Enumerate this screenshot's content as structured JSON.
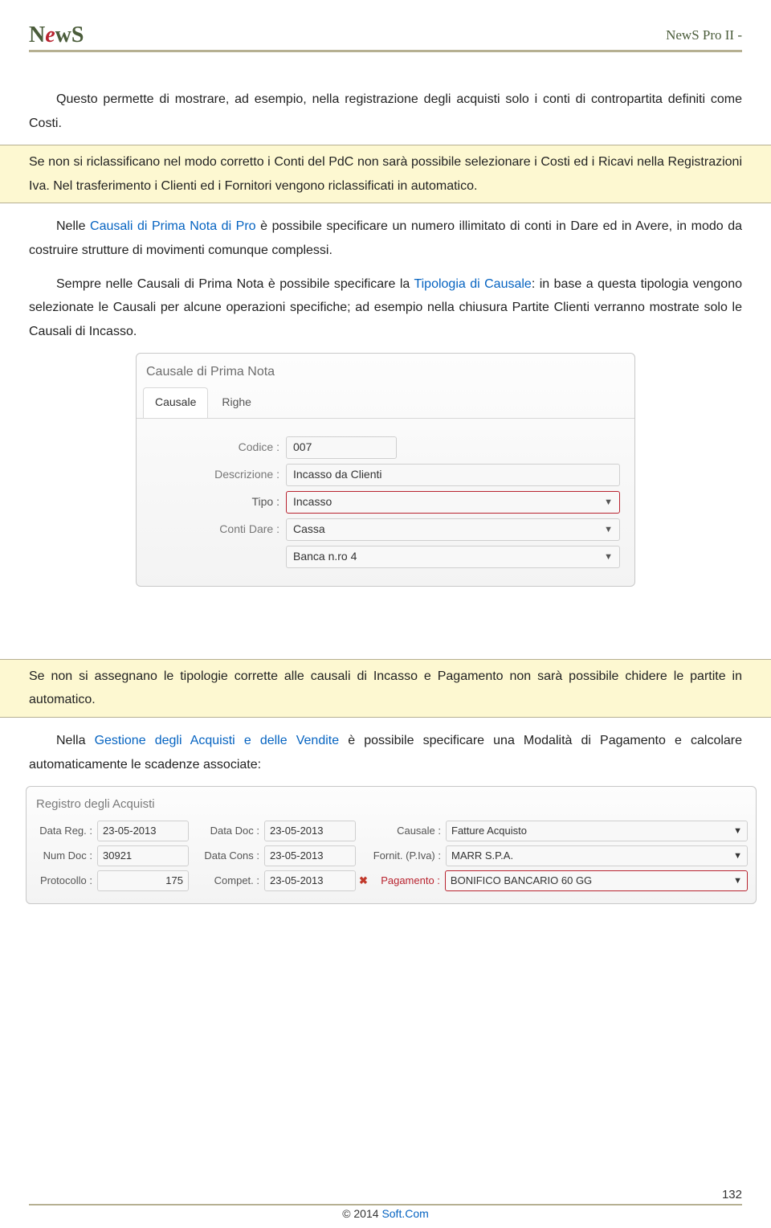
{
  "header": {
    "logo_n": "N",
    "logo_e": "e",
    "logo_w": "w",
    "logo_s": "S",
    "app_title": "NewS Pro II -"
  },
  "paras": {
    "p1": "Questo permette di mostrare, ad esempio, nella registrazione degli acquisti solo i conti di contropartita definiti come Costi.",
    "hl1": "Se non si riclassificano nel modo corretto i Conti del PdC non sarà possibile selezionare i Costi ed i Ricavi nella Registrazioni Iva. Nel trasferimento i Clienti ed i Fornitori vengono riclassificati in automatico.",
    "p2a": "Nelle ",
    "p2link": "Causali di Prima Nota di Pro",
    "p2b": " è possibile specificare un numero illimitato di conti in Dare ed in Avere, in modo da costruire strutture di movimenti comunque complessi.",
    "p3a": "Sempre nelle Causali di Prima Nota è possibile specificare la ",
    "p3link": "Tipologia di Causale",
    "p3b": ": in base a questa tipologia vengono selezionate le Causali per alcune operazioni specifiche; ad esempio nella chiusura Partite Clienti verranno mostrate solo le Causali di Incasso.",
    "hl2": "Se non si assegnano le tipologie corrette alle causali di Incasso e Pagamento non sarà possibile chidere le partite in automatico.",
    "p4a": "Nella ",
    "p4link": "Gestione degli Acquisti e delle Vendite",
    "p4b": " è possibile specificare una Modalità di Pagamento e calcolare automaticamente le scadenze associate:"
  },
  "win1": {
    "title": "Causale di Prima Nota",
    "tab1": "Causale",
    "tab2": "Righe",
    "labels": {
      "codice": "Codice :",
      "descrizione": "Descrizione :",
      "tipo": "Tipo :",
      "conti": "Conti Dare :"
    },
    "values": {
      "codice": "007",
      "descrizione": "Incasso da Clienti",
      "tipo": "Incasso",
      "conti1": "Cassa",
      "conti2": "Banca n.ro 4"
    }
  },
  "win2": {
    "title": "Registro degli Acquisti",
    "labels": {
      "datareg": "Data Reg. :",
      "datadoc": "Data Doc :",
      "causale": "Causale :",
      "numdoc": "Num Doc :",
      "datacons": "Data Cons :",
      "fornit": "Fornit. (P.Iva) :",
      "protocollo": "Protocollo :",
      "compet": "Compet. :",
      "pagamento": "Pagamento :"
    },
    "values": {
      "datareg": "23-05-2013",
      "datadoc": "23-05-2013",
      "causale": "Fatture Acquisto",
      "numdoc": "30921",
      "datacons": "23-05-2013",
      "fornit": "MARR S.P.A.",
      "protocollo": "175",
      "compet": "23-05-2013",
      "pagamento": "BONIFICO BANCARIO 60 GG"
    }
  },
  "footer": {
    "page": "132",
    "copyright": "© 2014 ",
    "link": "Soft.Com"
  }
}
